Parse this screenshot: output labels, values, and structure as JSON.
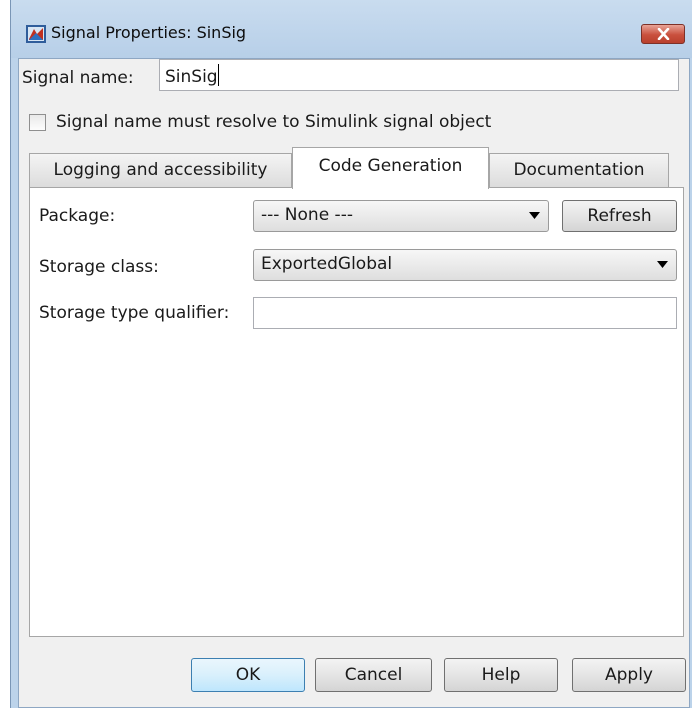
{
  "window": {
    "title": "Signal Properties: SinSig"
  },
  "signal_name": {
    "label": "Signal name:",
    "value": "SinSig"
  },
  "resolve_checkbox": {
    "label": "Signal name must resolve to Simulink signal object",
    "checked": false
  },
  "tabs": [
    {
      "label": "Logging and accessibility",
      "active": false
    },
    {
      "label": "Code Generation",
      "active": true
    },
    {
      "label": "Documentation",
      "active": false
    }
  ],
  "code_generation": {
    "package_label": "Package:",
    "package_value": "--- None ---",
    "refresh_label": "Refresh",
    "storage_class_label": "Storage class:",
    "storage_class_value": "ExportedGlobal",
    "storage_type_qualifier_label": "Storage type qualifier:",
    "storage_type_qualifier_value": ""
  },
  "buttons": {
    "ok": "OK",
    "cancel": "Cancel",
    "help": "Help",
    "apply": "Apply"
  },
  "icons": {
    "app": "simulink-icon",
    "close": "close-icon",
    "dropdown": "dropdown-arrow-icon"
  },
  "colors": {
    "title_bar": "#bcd3ea",
    "close_button": "#c9503d",
    "panel": "#ffffff"
  }
}
